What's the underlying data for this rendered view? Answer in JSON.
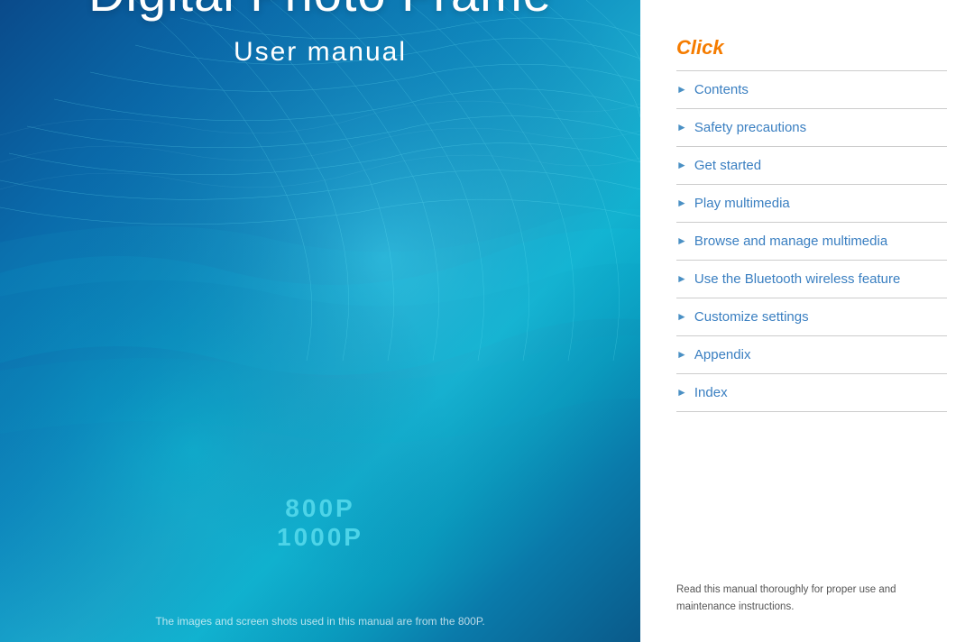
{
  "left": {
    "title": "Digital Photo Frame",
    "subtitle": "User manual",
    "models": [
      "800P",
      "1000P"
    ],
    "bottom_note": "The images and screen shots used in this manual are from the 800P."
  },
  "right": {
    "click_label": "Click",
    "nav_items": [
      {
        "id": "contents",
        "label": "Contents"
      },
      {
        "id": "safety-precautions",
        "label": "Safety precautions"
      },
      {
        "id": "get-started",
        "label": "Get started"
      },
      {
        "id": "play-multimedia",
        "label": "Play multimedia"
      },
      {
        "id": "browse-and-manage",
        "label": "Browse and manage multimedia"
      },
      {
        "id": "bluetooth",
        "label": "Use the Bluetooth wireless feature"
      },
      {
        "id": "customize-settings",
        "label": "Customize settings"
      },
      {
        "id": "appendix",
        "label": "Appendix"
      },
      {
        "id": "index",
        "label": "Index"
      }
    ],
    "footer_note": "Read this manual thoroughly for proper use and maintenance instructions."
  }
}
